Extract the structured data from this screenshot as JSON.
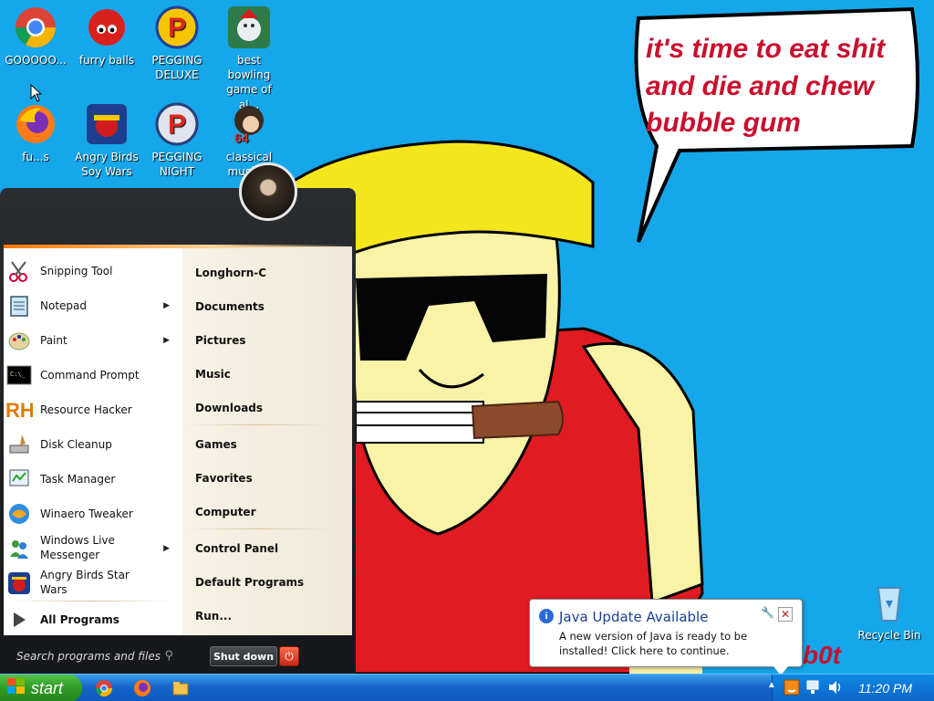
{
  "desktop": {
    "speech_bubble": "it's time to eat shit and die and chew bubble gum",
    "signature": "b0t",
    "icons": [
      {
        "label": "GOOOOO...",
        "icon": "chrome-icon"
      },
      {
        "label": "furry balls",
        "icon": "furry-ball-icon"
      },
      {
        "label": "PEGGING DELUXE",
        "icon": "pegging-p-icon"
      },
      {
        "label": "best bowling game of al...",
        "icon": "bowling-icon"
      },
      {
        "label": "fu...s",
        "icon": "firefox-icon"
      },
      {
        "label": "Angry Birds Soy Wars",
        "icon": "angry-birds-icon"
      },
      {
        "label": "PEGGING NIGHT",
        "icon": "pegging-p-icon"
      },
      {
        "label": "classical music...",
        "icon": "classical-music-icon"
      },
      {
        "label": "Recycle Bin",
        "icon": "recycle-bin-icon"
      }
    ]
  },
  "start_menu": {
    "programs": [
      {
        "label": "Snipping Tool",
        "icon": "scissors-icon",
        "submenu": false
      },
      {
        "label": "Notepad",
        "icon": "notepad-icon",
        "submenu": true
      },
      {
        "label": "Paint",
        "icon": "paint-palette-icon",
        "submenu": true
      },
      {
        "label": "Command Prompt",
        "icon": "cmd-icon",
        "submenu": false
      },
      {
        "label": "Resource Hacker",
        "icon": "rh-icon",
        "submenu": false
      },
      {
        "label": "Disk Cleanup",
        "icon": "disk-cleanup-icon",
        "submenu": false
      },
      {
        "label": "Task Manager",
        "icon": "task-manager-icon",
        "submenu": false
      },
      {
        "label": "Winaero Tweaker",
        "icon": "winaero-icon",
        "submenu": false
      },
      {
        "label": "Windows Live Messenger",
        "icon": "messenger-icon",
        "submenu": true
      },
      {
        "label": "Angry Birds Star Wars",
        "icon": "angry-birds-icon",
        "submenu": false
      }
    ],
    "all_programs": "All Programs",
    "places": [
      "Longhorn-C",
      "Documents",
      "Pictures",
      "Music",
      "Downloads",
      "Games",
      "Favorites",
      "Computer",
      "Control Panel",
      "Default Programs",
      "Run..."
    ],
    "search_placeholder": "Search programs and files",
    "shutdown_label": "Shut down"
  },
  "taskbar": {
    "start_label": "start",
    "pinned": [
      "chrome-icon",
      "firefox-icon",
      "explorer-icon"
    ],
    "clock": "11:20 PM"
  },
  "balloon": {
    "title": "Java Update Available",
    "message": "A new version of Java is ready to be installed! Click here to continue."
  },
  "colors": {
    "desktop_bg": "#15a7ea",
    "bubble_text": "#c8102e",
    "start_button": "#2f9a25",
    "taskbar": "#1765c9"
  }
}
